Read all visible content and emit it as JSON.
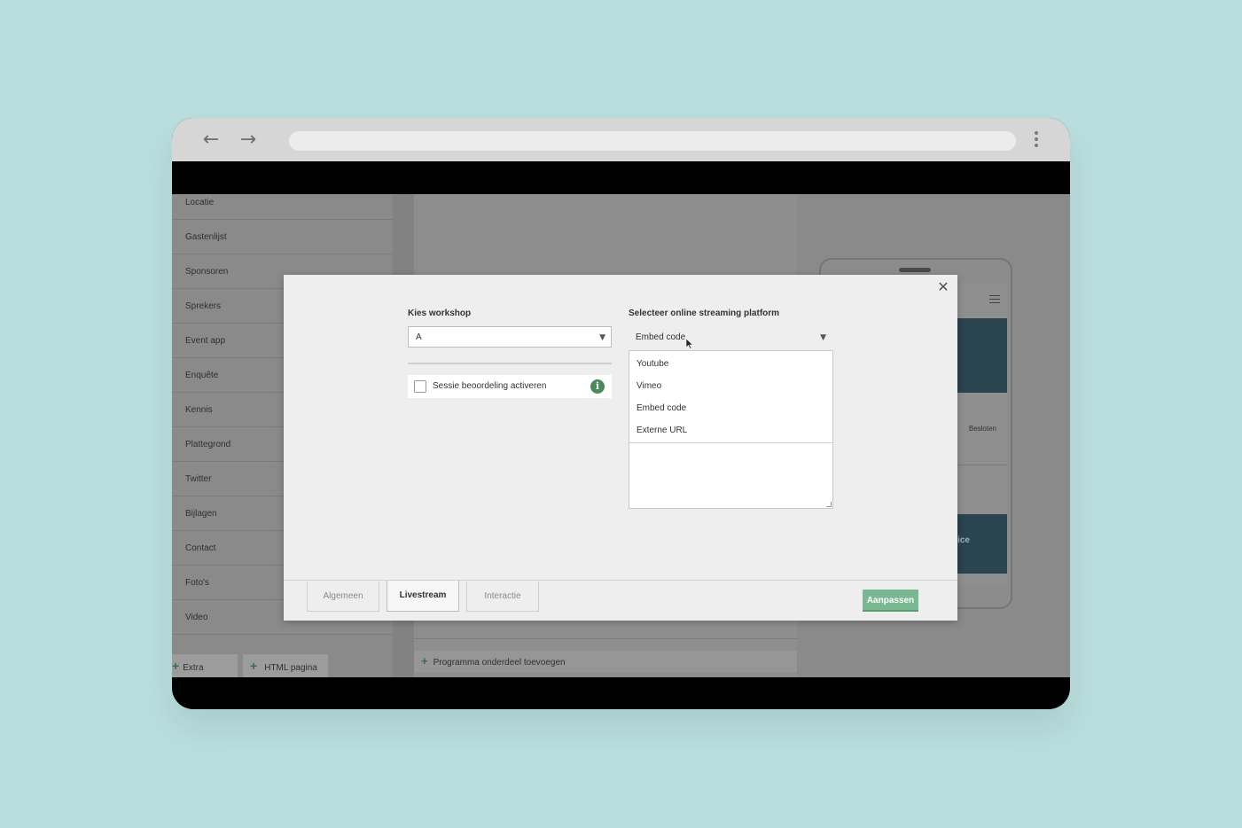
{
  "sidebar": {
    "items": [
      {
        "label": "Locatie"
      },
      {
        "label": "Gastenlijst"
      },
      {
        "label": "Sponsoren"
      },
      {
        "label": "Sprekers"
      },
      {
        "label": "Event app"
      },
      {
        "label": "Enquête"
      },
      {
        "label": "Kennis"
      },
      {
        "label": "Plattegrond"
      },
      {
        "label": "Twitter"
      },
      {
        "label": "Bijlagen"
      },
      {
        "label": "Contact"
      },
      {
        "label": "Foto's"
      },
      {
        "label": "Video"
      }
    ],
    "extra_page_label": "Extra pagina",
    "html_page_label": "HTML pagina"
  },
  "main": {
    "add_program_label": "Programma onderdeel toevoegen"
  },
  "phone_preview": {
    "besloten_label": "Besloten",
    "banner_text": "nice"
  },
  "modal": {
    "workshop_label": "Kies workshop",
    "workshop_value": "A",
    "session_rating_label": "Sessie beoordeling activeren",
    "platform_label": "Selecteer online streaming platform",
    "platform_value": "Embed code",
    "platform_options": [
      "Youtube",
      "Vimeo",
      "Embed code",
      "Externe URL"
    ],
    "tabs": [
      {
        "label": "Algemeen"
      },
      {
        "label": "Livestream"
      },
      {
        "label": "Interactie"
      }
    ],
    "save_label": "Aanpassen"
  },
  "colors": {
    "background": "#b8dedd",
    "accent_green": "#7ab892",
    "info_green": "#4b8a5c",
    "phone_blue": "#2a4450"
  }
}
